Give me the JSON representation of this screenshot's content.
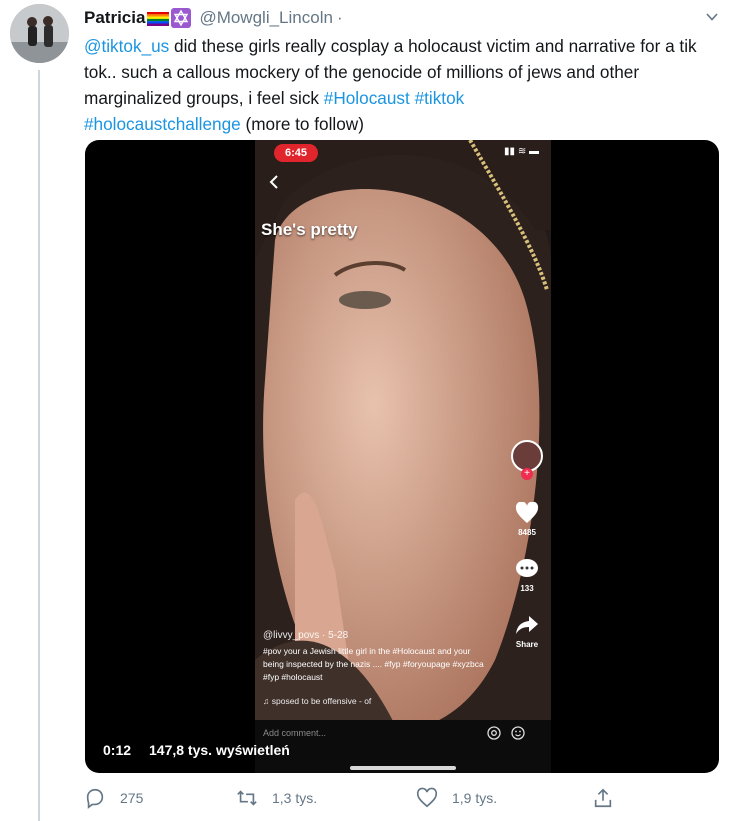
{
  "tweet": {
    "author_name": "Patricia",
    "author_handle": "@Mowgli_Lincoln",
    "separator": "·",
    "text": {
      "mention": "@tiktok_us",
      "body": " did these girls really cosplay a holocaust victim and narrative for a tik tok.. such a callous mockery of the genocide of millions of jews and other marginalized groups, i feel sick ",
      "hashtag1": "#Holocaust",
      "hashtag2": "#tiktok",
      "hashtag3": "#holocaustchallenge",
      "tail": " (more to follow)"
    }
  },
  "video": {
    "elapsed": "0:12",
    "views": "147,8 tys. wyświetleń",
    "tiktok": {
      "clock": "6:45",
      "overlay_caption": "She's pretty",
      "like_count": "8485",
      "comment_count": "133",
      "share_label": "Share",
      "username": "@livvy_povs · 5-28",
      "description": "#pov your a Jewish little girl in the #Holocaust and your being inspected by the nazis .... #fyp #foryoupage #xyzbca #fyp #holocaust",
      "sound": "♫  sposed to be offensive - of",
      "comment_placeholder": "Add comment..."
    }
  },
  "actions": {
    "replies": "275",
    "retweets": "1,3 tys.",
    "likes": "1,9 tys."
  },
  "colors": {
    "link": "#1b95e0",
    "muted": "#657786",
    "thread_line": "#ccd6dd",
    "media_bg": "#000000"
  },
  "icons": [
    "chevron-down-icon",
    "rainbow-flag-icon",
    "star-of-david-icon",
    "reply-icon",
    "retweet-icon",
    "like-icon",
    "share-icon",
    "heart-icon",
    "comment-bubble-icon",
    "share-arrow-icon",
    "at-icon",
    "emoji-icon",
    "back-chevron-icon"
  ]
}
